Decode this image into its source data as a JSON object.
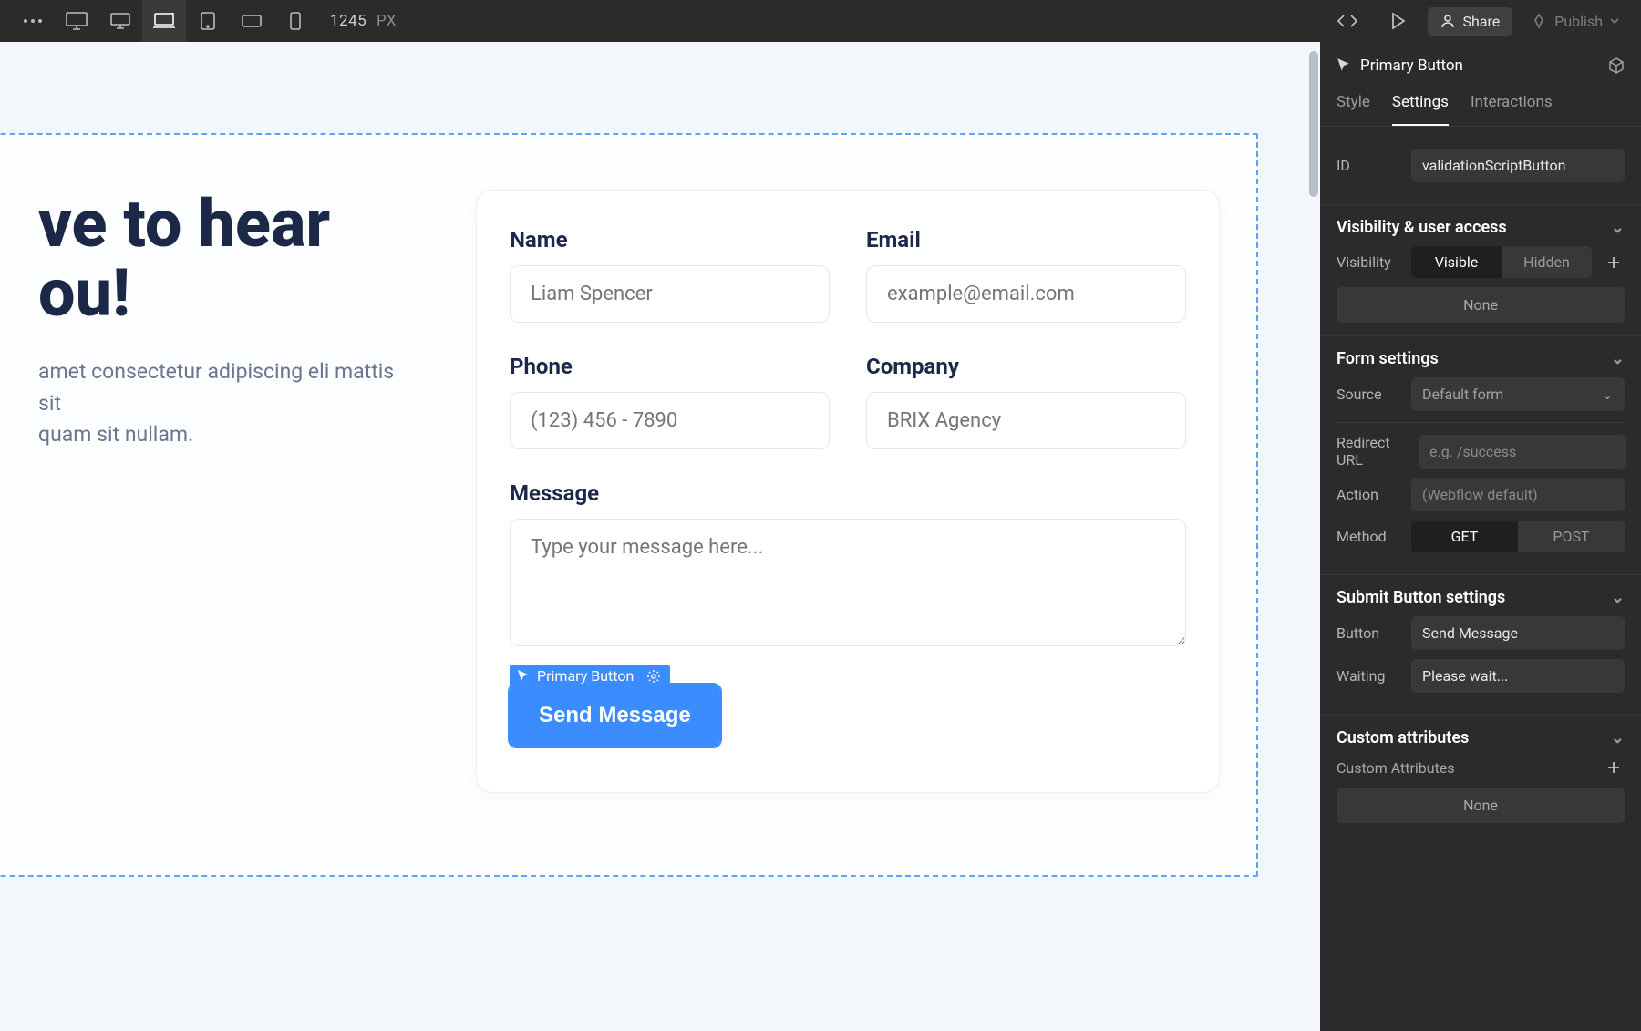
{
  "topbar": {
    "width_value": "1245",
    "width_unit": "PX",
    "share_label": "Share",
    "publish_label": "Publish"
  },
  "canvas": {
    "hero_title_line1": "ve to hear",
    "hero_title_line2": "ou!",
    "hero_sub_line1": "amet consectetur adipiscing eli mattis sit",
    "hero_sub_line2": "quam sit nullam.",
    "form": {
      "name_label": "Name",
      "name_placeholder": "Liam Spencer",
      "email_label": "Email",
      "email_placeholder": "example@email.com",
      "phone_label": "Phone",
      "phone_placeholder": "(123) 456 - 7890",
      "company_label": "Company",
      "company_placeholder": "BRIX Agency",
      "message_label": "Message",
      "message_placeholder": "Type your message here...",
      "selected_tag_label": "Primary Button",
      "submit_label": "Send Message"
    }
  },
  "inspector": {
    "element_name": "Primary Button",
    "tabs": {
      "style": "Style",
      "settings": "Settings",
      "interactions": "Interactions"
    },
    "id_label": "ID",
    "id_value": "validationScriptButton",
    "visibility_heading": "Visibility & user access",
    "visibility_label": "Visibility",
    "visible": "Visible",
    "hidden": "Hidden",
    "none": "None",
    "form_heading": "Form settings",
    "source_label": "Source",
    "source_value": "Default form",
    "redirect_label_l1": "Redirect",
    "redirect_label_l2": "URL",
    "redirect_placeholder": "e.g. /success",
    "action_label": "Action",
    "action_placeholder": "(Webflow default)",
    "method_label": "Method",
    "method_get": "GET",
    "method_post": "POST",
    "submit_heading": "Submit Button settings",
    "button_label": "Button",
    "button_value": "Send Message",
    "waiting_label": "Waiting",
    "waiting_value": "Please wait...",
    "custom_heading": "Custom attributes",
    "custom_sub": "Custom Attributes"
  }
}
